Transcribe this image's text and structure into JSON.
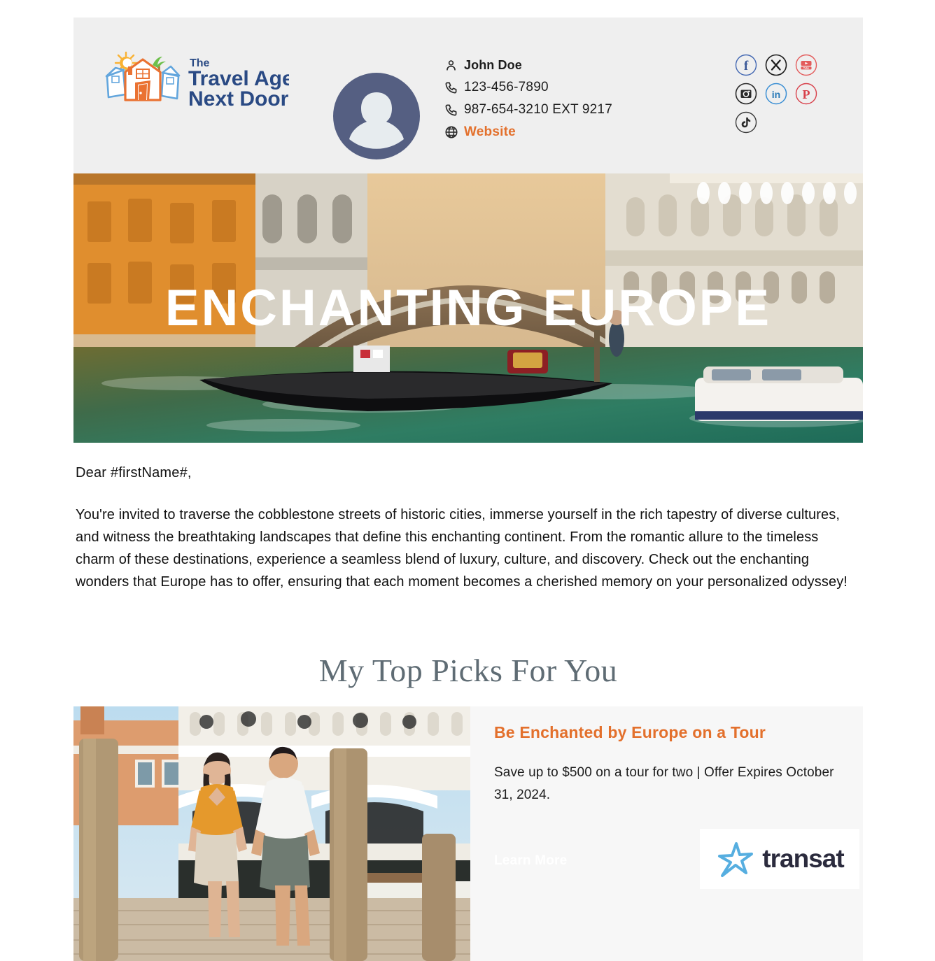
{
  "header": {
    "logo": {
      "icon": "travel-agent-next-door-logo",
      "line_the": "The",
      "line1": "Travel Agent",
      "line2": "Next Door"
    },
    "avatar_icon": "user-avatar-placeholder",
    "contact": {
      "name": "John Doe",
      "name_icon": "person-icon",
      "phone_primary": "123-456-7890",
      "phone_primary_icon": "phone-icon",
      "phone_secondary": "987-654-3210 EXT 9217",
      "phone_secondary_icon": "phone-icon",
      "website_label": "Website",
      "website_icon": "globe-icon"
    },
    "socials": [
      {
        "name": "facebook",
        "glyph": "f",
        "color": "#3b5998"
      },
      {
        "name": "x-twitter",
        "glyph": "X",
        "color": "#1d1d1d"
      },
      {
        "name": "youtube",
        "glyph": "You Tube",
        "color": "#e35b5b"
      },
      {
        "name": "instagram",
        "glyph": "camera",
        "color": "#2b2b2b"
      },
      {
        "name": "linkedin",
        "glyph": "in",
        "color": "#3b8fd4"
      },
      {
        "name": "pinterest",
        "glyph": "P",
        "color": "#d8414b"
      },
      {
        "name": "tiktok",
        "glyph": "note",
        "color": "#3a3a3a"
      }
    ],
    "background_color": "#efefef"
  },
  "hero": {
    "title": "ENCHANTING EUROPE",
    "image_alt": "venice-rialto-bridge-gondola"
  },
  "body": {
    "greeting": "Dear #firstName#,",
    "paragraph": "You're invited to traverse the cobblestone streets of historic cities, immerse yourself in the rich tapestry of diverse cultures, and witness the breathtaking landscapes that define this enchanting continent. From the romantic allure to the timeless charm of these destinations, experience a seamless blend of luxury, culture, and discovery. Check out the enchanting wonders that Europe has to offer, ensuring that each moment becomes a cherished memory on your personalized odyssey!"
  },
  "section": {
    "heading": "My Top Picks For You"
  },
  "offer": {
    "image_alt": "couple-walking-venice-waterfront",
    "title": "Be Enchanted by Europe on a Tour",
    "subtitle": "Save up to $500 on a tour for two | Offer Expires October 31, 2024.",
    "cta_label": "Learn More",
    "brand_name": "transat",
    "brand_icon": "transat-star-icon",
    "accent_color": "#e3702c",
    "card_background": "#f7f7f7"
  }
}
